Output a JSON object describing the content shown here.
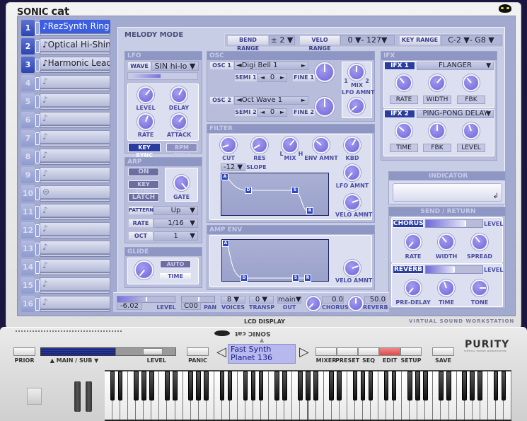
{
  "app": {
    "brand_main": "SONIC",
    "brand_sub": "cat",
    "footer_left": "LCD DISPLAY",
    "footer_right": "VIRTUAL SOUND WORKSTATION"
  },
  "parts": [
    {
      "num": "1",
      "name": "♪RezSynth Ring",
      "state": "selected"
    },
    {
      "num": "2",
      "name": "♪Optical Hi-Shine",
      "state": "active"
    },
    {
      "num": "3",
      "name": "♪Harmonic Lead",
      "state": "active"
    },
    {
      "num": "4",
      "name": "♪",
      "state": "empty"
    },
    {
      "num": "5",
      "name": "♪",
      "state": "empty"
    },
    {
      "num": "6",
      "name": "♪",
      "state": "empty"
    },
    {
      "num": "7",
      "name": "♪",
      "state": "empty"
    },
    {
      "num": "8",
      "name": "♪",
      "state": "empty"
    },
    {
      "num": "9",
      "name": "♪",
      "state": "empty"
    },
    {
      "num": "10",
      "name": "⊜",
      "state": "empty"
    },
    {
      "num": "11",
      "name": "♪",
      "state": "empty"
    },
    {
      "num": "12",
      "name": "♪",
      "state": "empty"
    },
    {
      "num": "13",
      "name": "♪",
      "state": "empty"
    },
    {
      "num": "14",
      "name": "♪",
      "state": "empty"
    },
    {
      "num": "15",
      "name": "♪",
      "state": "empty"
    },
    {
      "num": "16",
      "name": "♪",
      "state": "empty"
    }
  ],
  "mode": "MELODY MODE",
  "ranges": {
    "bend_label": "BEND RANGE",
    "bend_value": "± 2 ▼",
    "velo_label": "VELO RANGE",
    "velo_value": "0 ▼- 127▼",
    "key_label": "KEY RANGE",
    "key_value": "C-2 ▼- G8 ▼"
  },
  "lfo": {
    "title": "LFO",
    "wave_label": "WAVE",
    "wave_value": "SIN hi-lo ▼",
    "knobs": [
      "LEVEL",
      "DELAY",
      "RATE",
      "ATTACK"
    ],
    "key_sync": "KEY SYNC",
    "bpm_sync": "BPM SYNC"
  },
  "arp": {
    "title": "ARP",
    "on": "ON",
    "key_sync": "KEY SYNC",
    "latch": "LATCH",
    "gate": "GATE",
    "pattern_label": "PATTERN",
    "pattern_value": "Up",
    "rate_label": "RATE",
    "rate_value": "1/16",
    "oct_label": "OCT",
    "oct_value": "1"
  },
  "glide": {
    "title": "GLIDE",
    "auto": "AUTO",
    "time": "TIME"
  },
  "osc": {
    "title": "OSC",
    "osc1_label": "OSC 1",
    "osc1_wave": "◄Digi Bell 1",
    "semi1_label": "SEMI 1",
    "semi1_value": "0",
    "fine1_label": "FINE 1",
    "osc2_label": "OSC 2",
    "osc2_wave": "◄Oct Wave 1",
    "semi2_label": "SEMI 2",
    "semi2_value": "0",
    "fine2_label": "FINE 2",
    "mix_label": "MIX",
    "mix_left": "1",
    "mix_right": "2",
    "lfo_amnt": "LFO AMNT"
  },
  "filter": {
    "title": "FILTER",
    "knobs": [
      "CUT",
      "RES",
      "MIX",
      "ENV AMNT",
      "KBD"
    ],
    "mix_l": "L",
    "mix_h": "H",
    "slope_value": "-12 ▼",
    "slope_label": "SLOPE",
    "lfo_amnt": "LFO AMNT",
    "velo_amnt": "VELO AMNT",
    "env_nodes": [
      "A",
      "D",
      "S",
      "R"
    ]
  },
  "amp_env": {
    "title": "AMP ENV",
    "velo_amnt": "VELO AMNT",
    "env_nodes": [
      "A",
      "D",
      "S",
      "R"
    ]
  },
  "ifx": {
    "title": "IFX",
    "ifx1_label": "IFX 1",
    "ifx1_type": "FLANGER",
    "ifx1_params": [
      "RATE",
      "WIDTH",
      "FBK"
    ],
    "ifx2_label": "IFX 2",
    "ifx2_type": "PING-PONG DELAY",
    "ifx2_params": [
      "TIME",
      "FBK",
      "LEVEL"
    ]
  },
  "indicator": {
    "title": "INDICATOR",
    "enter": "↲"
  },
  "send_return": {
    "title": "SEND / RETURN",
    "chorus_label": "CHORUS",
    "chorus_level_label": "LEVEL",
    "chorus_level": 0.7,
    "chorus_knobs": [
      "RATE",
      "WIDTH",
      "SPREAD"
    ],
    "reverb_label": "REVERB",
    "reverb_level_label": "LEVEL",
    "reverb_level": 0.5,
    "reverb_knobs": [
      "PRE-DELAY",
      "TIME",
      "TONE"
    ]
  },
  "strip": {
    "level_value": "-6.02",
    "level_label": "LEVEL",
    "pan_value": "C00",
    "pan_label": "PAN",
    "voices_value": "8 ▼",
    "voices_label": "VOICES",
    "transp_value": "0 ▼",
    "transp_label": "TRANSP",
    "out_value": "main▼",
    "out_label": "OUT",
    "chorus_value": "0.0",
    "chorus_label": "CHORUS",
    "reverb_value": "50.0",
    "reverb_label": "REVERB"
  },
  "hardware": {
    "prior": "PRIOR",
    "main_sub": "▲ MAIN / SUB ▼",
    "level": "LEVEL",
    "panic": "PANIC",
    "lcd_line1": "Fast Synth",
    "lcd_line2": "Planet 136",
    "mixer": "MIXER",
    "preset": "PRESET",
    "seq": "SEQ",
    "edit": "EDIT",
    "setup": "SETUP",
    "save": "SAVE",
    "logo": "PURITY",
    "logo_sub": "VIRTUAL SOUND WORKSTATION",
    "active_mode": "EDIT",
    "active_color": "#e04848"
  }
}
